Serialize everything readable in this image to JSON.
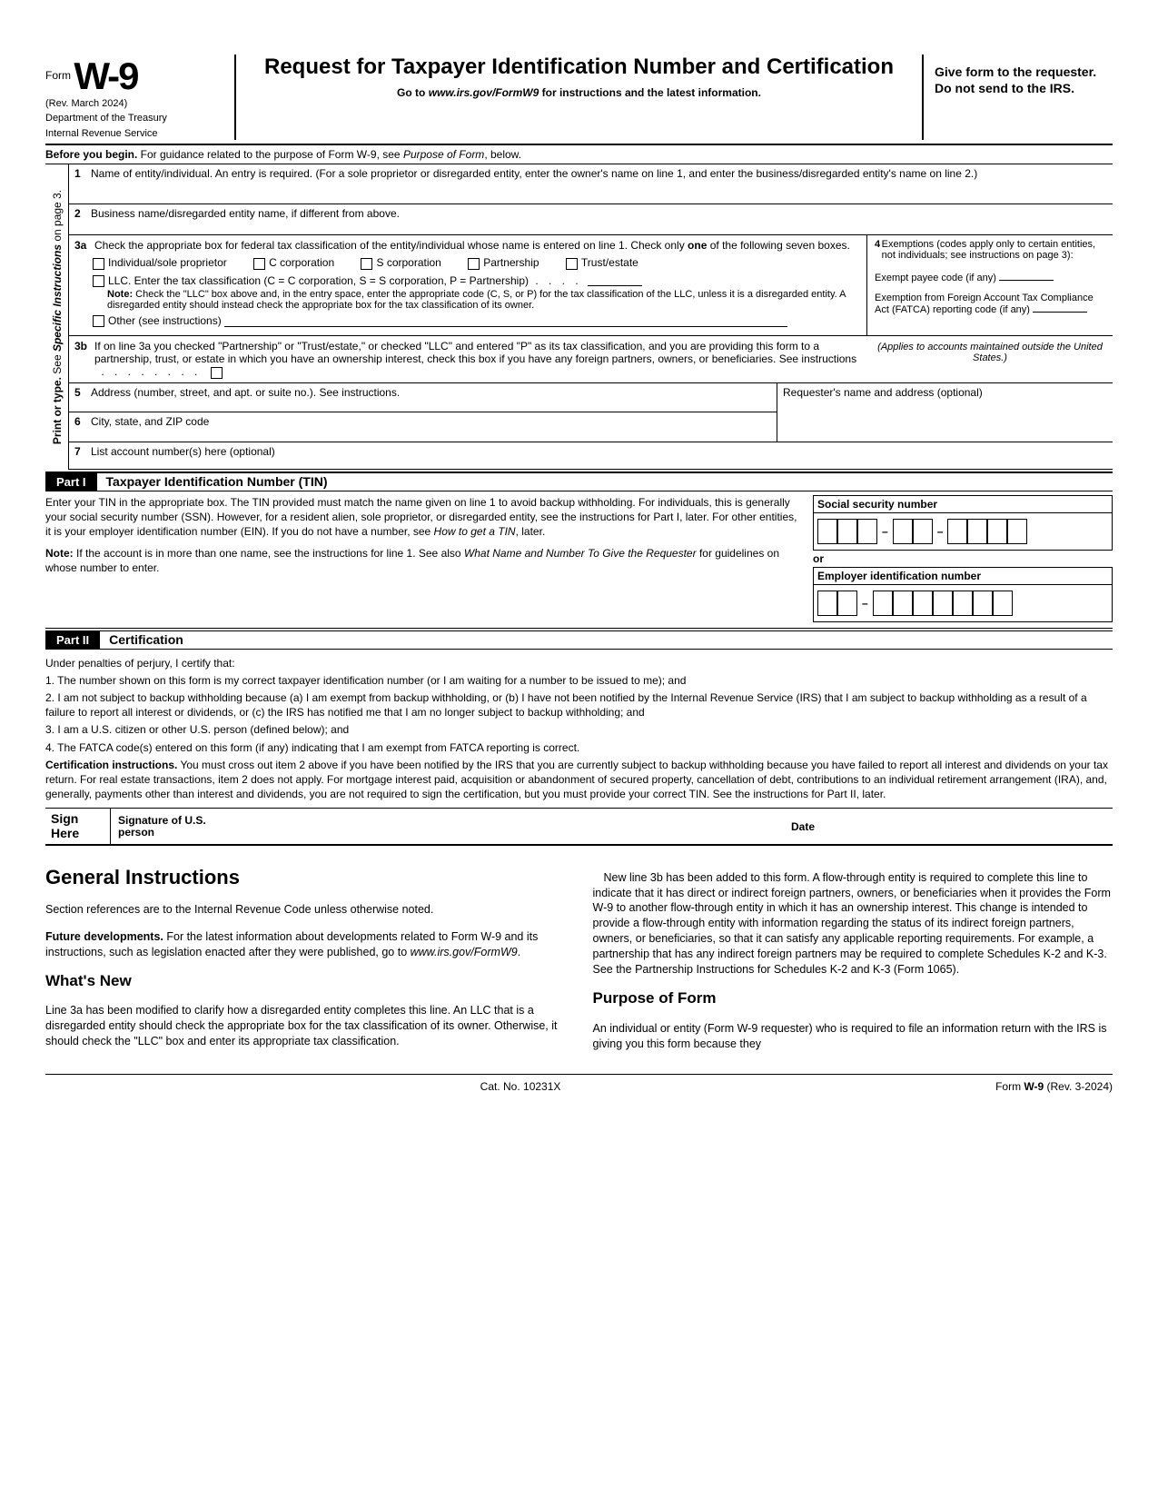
{
  "header": {
    "form_label": "Form",
    "form_number": "W-9",
    "revision": "(Rev. March 2024)",
    "dept1": "Department of the Treasury",
    "dept2": "Internal Revenue Service",
    "title": "Request for Taxpayer Identification Number and Certification",
    "goto": "Go to www.irs.gov/FormW9 for instructions and the latest information.",
    "give": "Give form to the requester. Do not send to the IRS."
  },
  "before": "Before you begin. For guidance related to the purpose of Form W-9, see Purpose of Form, below.",
  "side_label": "Print or type.",
  "side_label2": "See Specific Instructions on page 3.",
  "line1": {
    "num": "1",
    "txt": "Name of entity/individual. An entry is required. (For a sole proprietor or disregarded entity, enter the owner's name on line 1, and enter the business/disregarded entity's name on line 2.)"
  },
  "line2": {
    "num": "2",
    "txt": "Business name/disregarded entity name, if different from above."
  },
  "line3a": {
    "num": "3a",
    "intro": "Check the appropriate box for federal tax classification of the entity/individual whose name is entered on line 1. Check only one of the following seven boxes.",
    "opts": {
      "ind": "Individual/sole proprietor",
      "ccorp": "C corporation",
      "scorp": "S corporation",
      "part": "Partnership",
      "trust": "Trust/estate"
    },
    "llc": "LLC. Enter the tax classification (C = C corporation, S = S corporation, P = Partnership)",
    "llc_note": "Note: Check the \"LLC\" box above and, in the entry space, enter the appropriate code (C, S, or P) for the tax classification of the LLC, unless it is a disregarded entity. A disregarded entity should instead check the appropriate box for the tax classification of its owner.",
    "other": "Other (see instructions)"
  },
  "line4": {
    "num": "4",
    "intro": "Exemptions (codes apply only to certain entities, not individuals; see instructions on page 3):",
    "payee": "Exempt payee code (if any)",
    "fatca": "Exemption from Foreign Account Tax Compliance Act (FATCA) reporting code (if any)"
  },
  "line3b": {
    "num": "3b",
    "txt": "If on line 3a you checked \"Partnership\" or \"Trust/estate,\" or checked \"LLC\" and entered \"P\" as its tax classification, and you are providing this form to a partnership, trust, or estate in which you have an ownership interest, check this box if you have any foreign partners, owners, or beneficiaries. See instructions",
    "right": "(Applies to accounts maintained outside the United States.)"
  },
  "line5": {
    "num": "5",
    "txt": "Address (number, street, and apt. or suite no.). See instructions."
  },
  "line6": {
    "num": "6",
    "txt": "City, state, and ZIP code"
  },
  "line7": {
    "num": "7",
    "txt": "List account number(s) here (optional)"
  },
  "requester": "Requester's name and address (optional)",
  "part1": {
    "tag": "Part I",
    "title": "Taxpayer Identification Number (TIN)",
    "body1": "Enter your TIN in the appropriate box. The TIN provided must match the name given on line 1 to avoid backup withholding. For individuals, this is generally your social security number (SSN). However, for a resident alien, sole proprietor, or disregarded entity, see the instructions for Part I, later. For other entities, it is your employer identification number (EIN). If you do not have a number, see How to get a TIN, later.",
    "body2": "Note: If the account is in more than one name, see the instructions for line 1. See also What Name and Number To Give the Requester for guidelines on whose number to enter.",
    "ssn": "Social security number",
    "or": "or",
    "ein": "Employer identification number"
  },
  "part2": {
    "tag": "Part II",
    "title": "Certification",
    "intro": "Under penalties of perjury, I certify that:",
    "i1": "1. The number shown on this form is my correct taxpayer identification number (or I am waiting for a number to be issued to me); and",
    "i2": "2. I am not subject to backup withholding because (a) I am exempt from backup withholding, or (b) I have not been notified by the Internal Revenue Service (IRS) that I am subject to backup withholding as a result of a failure to report all interest or dividends, or (c) the IRS has notified me that I am no longer subject to backup withholding; and",
    "i3": "3. I am a U.S. citizen or other U.S. person (defined below); and",
    "i4": "4. The FATCA code(s) entered on this form (if any) indicating that I am exempt from FATCA reporting is correct.",
    "cert": "Certification instructions. You must cross out item 2 above if you have been notified by the IRS that you are currently subject to backup withholding because you have failed to report all interest and dividends on your tax return. For real estate transactions, item 2 does not apply. For mortgage interest paid, acquisition or abandonment of secured property, cancellation of debt, contributions to an individual retirement arrangement (IRA), and, generally, payments other than interest and dividends, you are not required to sign the certification, but you must provide your correct TIN. See the instructions for Part II, later."
  },
  "sign": {
    "here": "Sign Here",
    "sig": "Signature of U.S. person",
    "date": "Date"
  },
  "instr": {
    "gi": "General Instructions",
    "gi1": "Section references are to the Internal Revenue Code unless otherwise noted.",
    "gi2": "Future developments. For the latest information about developments related to Form W-9 and its instructions, such as legislation enacted after they were published, go to www.irs.gov/FormW9.",
    "wn": "What's New",
    "wn1": "Line 3a has been modified to clarify how a disregarded entity completes this line. An LLC that is a disregarded entity should check the appropriate box for the tax classification of its owner. Otherwise, it should check the \"LLC\" box and enter its appropriate tax classification.",
    "col2a": "New line 3b has been added to this form. A flow-through entity is required to complete this line to indicate that it has direct or indirect foreign partners, owners, or beneficiaries when it provides the Form W-9 to another flow-through entity in which it has an ownership interest. This change is intended to provide a flow-through entity with information regarding the status of its indirect foreign partners, owners, or beneficiaries, so that it can satisfy any applicable reporting requirements. For example, a partnership that has any indirect foreign partners may be required to complete Schedules K-2 and K-3. See the Partnership Instructions for Schedules K-2 and K-3 (Form 1065).",
    "pf": "Purpose of Form",
    "pf1": "An individual or entity (Form W-9 requester) who is required to file an information return with the IRS is giving you this form because they"
  },
  "footer": {
    "cat": "Cat. No. 10231X",
    "rev": "Form W-9 (Rev. 3-2024)"
  }
}
